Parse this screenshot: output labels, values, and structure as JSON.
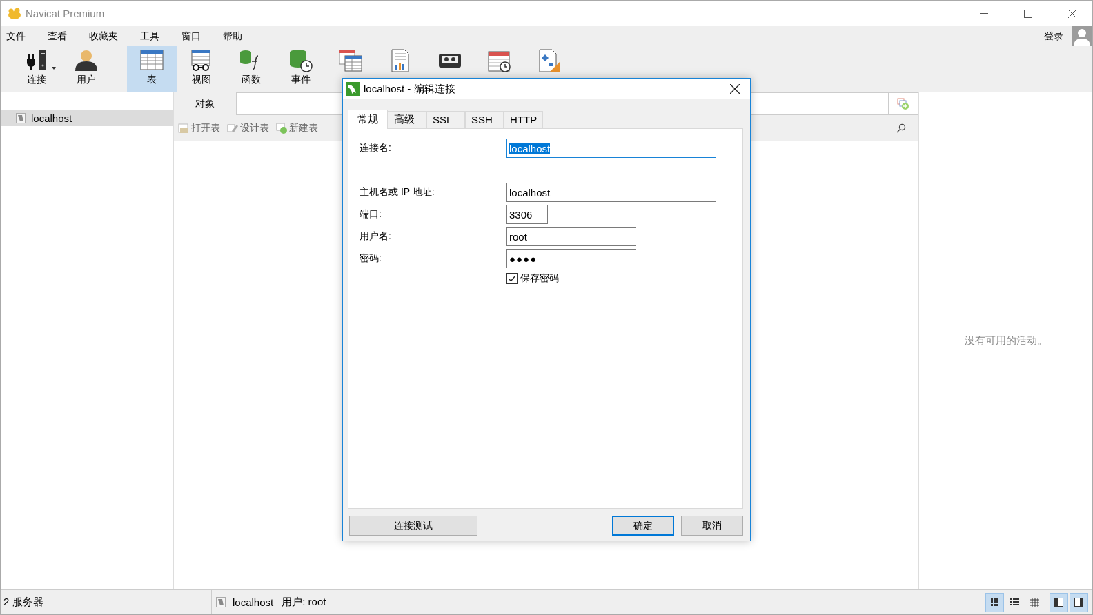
{
  "window": {
    "title": "Navicat Premium"
  },
  "menu": [
    "文件",
    "查看",
    "收藏夹",
    "工具",
    "窗口",
    "帮助"
  ],
  "login": "登录",
  "toolbar": [
    {
      "label": "连接",
      "kind": "connect",
      "selected": false,
      "dropdown": true
    },
    {
      "label": "用户",
      "kind": "user",
      "selected": false,
      "dropdown": false
    },
    {
      "label": "表",
      "kind": "table",
      "selected": true,
      "dropdown": false
    },
    {
      "label": "视图",
      "kind": "view",
      "selected": false,
      "dropdown": false
    },
    {
      "label": "函数",
      "kind": "function",
      "selected": false,
      "dropdown": false
    },
    {
      "label": "事件",
      "kind": "event",
      "selected": false,
      "dropdown": false
    },
    {
      "kind": "query",
      "selected": false,
      "dropdown": false
    },
    {
      "kind": "report",
      "selected": false,
      "dropdown": false
    },
    {
      "kind": "backup",
      "selected": false,
      "dropdown": false
    },
    {
      "kind": "schedule",
      "selected": false,
      "dropdown": false
    },
    {
      "kind": "model",
      "selected": false,
      "dropdown": false
    }
  ],
  "sidebar": {
    "items": [
      {
        "label": "localhost",
        "selected": true
      }
    ]
  },
  "object_tabs": [
    {
      "label": "对象",
      "selected": true
    }
  ],
  "actions": [
    {
      "label": "打开表",
      "kind": "open"
    },
    {
      "label": "设计表",
      "kind": "design"
    },
    {
      "label": "新建表",
      "kind": "new"
    }
  ],
  "activity": {
    "message": "没有可用的活动。"
  },
  "dialog": {
    "title": "localhost - 编辑连接",
    "tabs": [
      {
        "label": "常规",
        "selected": true
      },
      {
        "label": "高级",
        "selected": false
      },
      {
        "label": "SSL",
        "selected": false
      },
      {
        "label": "SSH",
        "selected": false
      },
      {
        "label": "HTTP",
        "selected": false
      }
    ],
    "fields": [
      {
        "label": "连接名:",
        "value": "localhost",
        "kind": "name",
        "highlighted": true
      },
      {
        "label": "主机名或 IP 地址:",
        "value": "localhost",
        "kind": "host",
        "highlighted": false
      },
      {
        "label": "端口:",
        "value": "3306",
        "kind": "port",
        "highlighted": false
      },
      {
        "label": "用户名:",
        "value": "root",
        "kind": "user",
        "highlighted": false
      },
      {
        "label": "密码:",
        "value": "●●●●",
        "kind": "password",
        "highlighted": false
      }
    ],
    "save_password": {
      "label": "保存密码",
      "checked": true
    },
    "buttons": [
      {
        "label": "连接测试",
        "kind": "test"
      },
      {
        "label": "确定",
        "kind": "default"
      },
      {
        "label": "取消",
        "kind": "plain"
      }
    ]
  },
  "status_bar": {
    "servers": "2 服务器",
    "connection": "localhost",
    "user": "用户: root",
    "views": [
      {
        "kind": "grid",
        "selected": true
      },
      {
        "kind": "list",
        "selected": false
      },
      {
        "kind": "detail",
        "selected": false
      },
      {
        "kind": "left-pane",
        "selected": true
      },
      {
        "kind": "right-pane",
        "selected": true
      }
    ]
  }
}
